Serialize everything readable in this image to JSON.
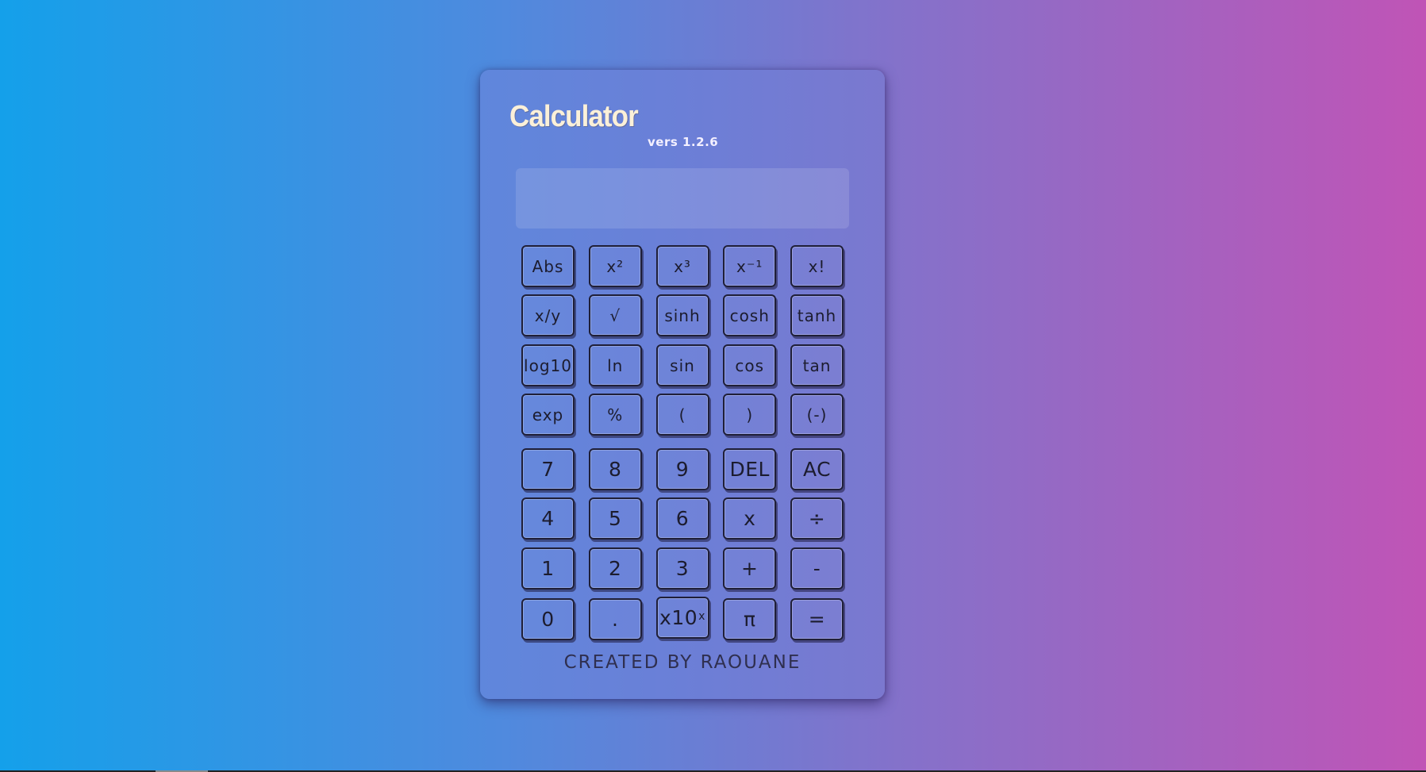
{
  "app": {
    "title": "Calculator",
    "version": "vers 1.2.6",
    "display_value": "",
    "credit": "CREATED BY RAOUANE"
  },
  "keypad": {
    "function_rows": [
      [
        "Abs",
        "x²",
        "x³",
        "x⁻¹",
        "x!"
      ],
      [
        "x/y",
        "√",
        "sinh",
        "cosh",
        "tanh"
      ],
      [
        "log10",
        "ln",
        "sin",
        "cos",
        "tan"
      ],
      [
        "exp",
        "%",
        "(",
        ")",
        "(-)"
      ]
    ],
    "number_rows": [
      [
        "7",
        "8",
        "9",
        "DEL",
        "AC"
      ],
      [
        "4",
        "5",
        "6",
        "x",
        "÷"
      ],
      [
        "1",
        "2",
        "3",
        "+",
        "-"
      ],
      [
        "0",
        ".",
        "x10",
        "π",
        "="
      ]
    ],
    "exponent_superscript": "x"
  },
  "colors": {
    "background_left": "#14a0ea",
    "background_right": "#c054b6",
    "title_color": "#fbf0d8",
    "button_border": "#1f1f38"
  }
}
